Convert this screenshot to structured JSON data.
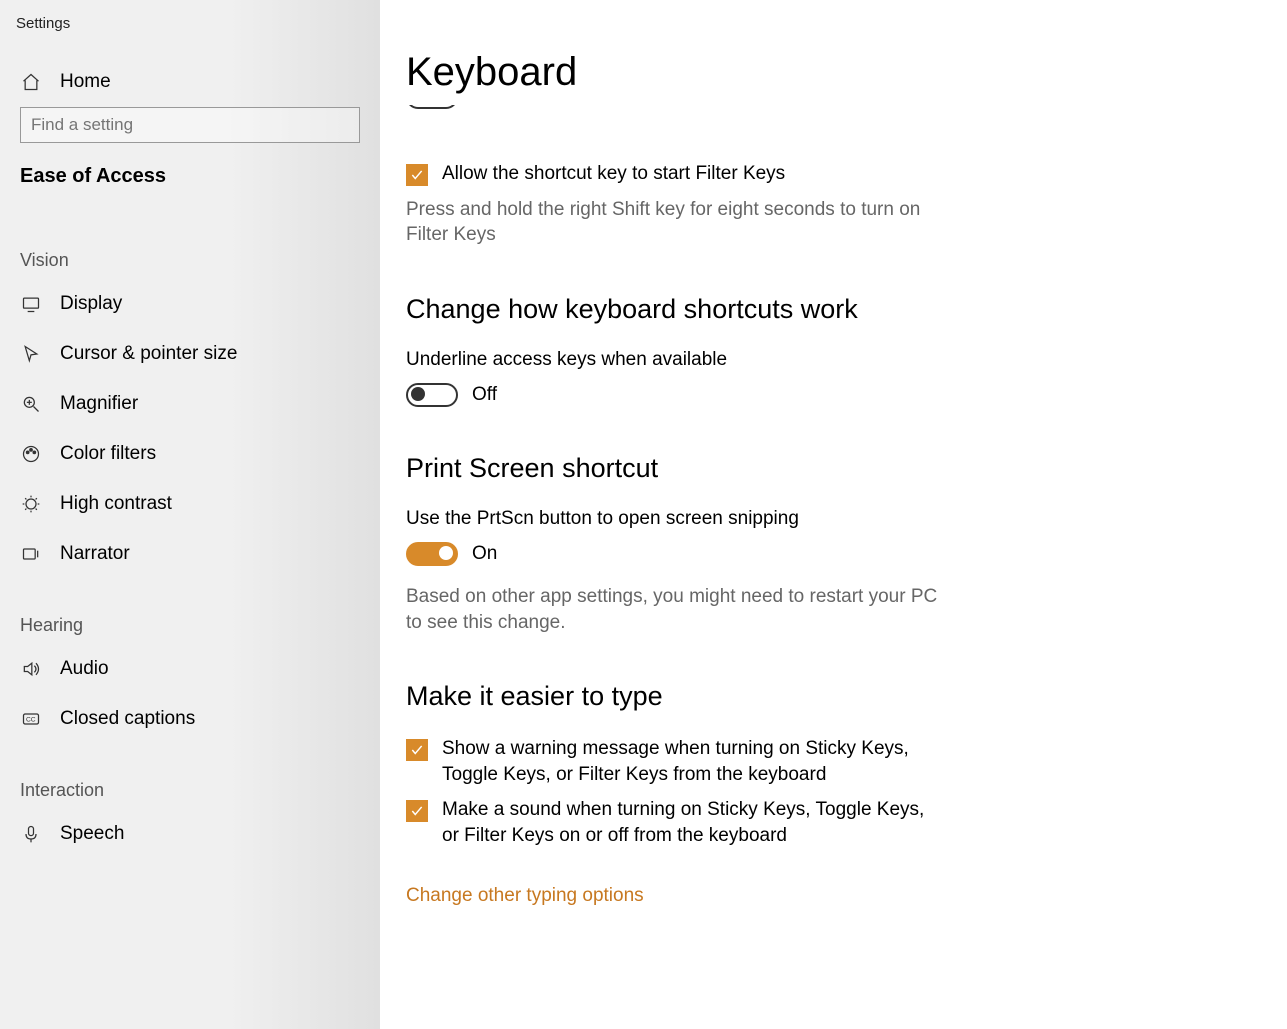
{
  "window_title": "Settings",
  "sidebar": {
    "home": "Home",
    "search_placeholder": "Find a setting",
    "section": "Ease of Access",
    "groups": [
      {
        "title": "Vision",
        "items": [
          {
            "name": "display",
            "label": "Display",
            "icon": "monitor-icon"
          },
          {
            "name": "cursor",
            "label": "Cursor & pointer size",
            "icon": "cursor-icon"
          },
          {
            "name": "magnifier",
            "label": "Magnifier",
            "icon": "magnifier-icon"
          },
          {
            "name": "colorfilters",
            "label": "Color filters",
            "icon": "palette-icon"
          },
          {
            "name": "highcontrast",
            "label": "High contrast",
            "icon": "contrast-icon"
          },
          {
            "name": "narrator",
            "label": "Narrator",
            "icon": "narrator-icon"
          }
        ]
      },
      {
        "title": "Hearing",
        "items": [
          {
            "name": "audio",
            "label": "Audio",
            "icon": "speaker-icon"
          },
          {
            "name": "closedcaptions",
            "label": "Closed captions",
            "icon": "cc-icon"
          }
        ]
      },
      {
        "title": "Interaction",
        "items": [
          {
            "name": "speech",
            "label": "Speech",
            "icon": "mic-icon"
          }
        ]
      }
    ]
  },
  "main": {
    "title": "Keyboard",
    "filter_keys_toggle": {
      "state": "Off"
    },
    "filter_keys_checkbox": "Allow the shortcut key to start Filter Keys",
    "filter_keys_note": "Press and hold the right Shift key for eight seconds to turn on Filter Keys",
    "section_shortcuts": {
      "title": "Change how keyboard shortcuts work",
      "underline_label": "Underline access keys when available",
      "underline_state": "Off"
    },
    "section_printscreen": {
      "title": "Print Screen shortcut",
      "label": "Use the PrtScn button to open screen snipping",
      "state": "On",
      "note": "Based on other app settings, you might need to restart your PC to see this change."
    },
    "section_easier": {
      "title": "Make it easier to type",
      "cb1": "Show a warning message when turning on Sticky Keys, Toggle Keys, or Filter Keys from the keyboard",
      "cb2": "Make a sound when turning on Sticky Keys, Toggle Keys, or Filter Keys on or off from the keyboard",
      "link": "Change other typing options"
    }
  }
}
